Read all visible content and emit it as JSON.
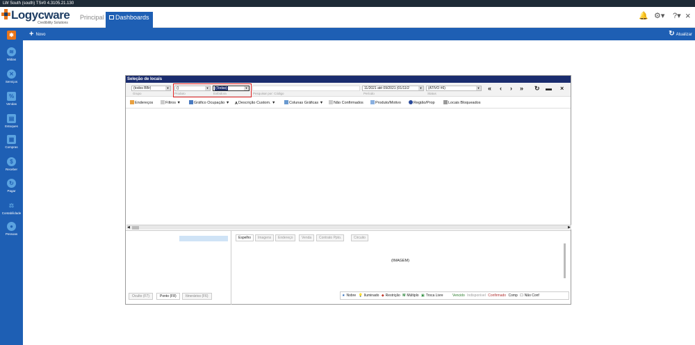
{
  "titlebar": {
    "text": "LW South (south) TS#0 4.3105.21.130"
  },
  "brand": {
    "name": "Logycware",
    "tagline": "Credibility Solutions"
  },
  "nav": {
    "tabs": [
      {
        "label": "Principal"
      },
      {
        "label": "Dashboards"
      }
    ]
  },
  "topicons": {
    "bell": "bell-icon",
    "settings": "gear-icon",
    "help": "?",
    "close": "×"
  },
  "actionbar": {
    "new_label": "Novo",
    "refresh_label": "Atualizar"
  },
  "sidebar": {
    "items": [
      {
        "label": "Mídias",
        "icon": "≋"
      },
      {
        "label": "Serviços",
        "icon": "✕"
      },
      {
        "label": "Vendas",
        "icon": "%"
      },
      {
        "label": "Estoques",
        "icon": "▤"
      },
      {
        "label": "Compras",
        "icon": "▦"
      },
      {
        "label": "Receber",
        "icon": "$"
      },
      {
        "label": "Pagar",
        "icon": "↻"
      },
      {
        "label": "Contabilidade",
        "icon": "⚖"
      },
      {
        "label": "Pessoas",
        "icon": "●"
      }
    ]
  },
  "dialog": {
    "title": "Seleção de locais",
    "filters": {
      "grupo": {
        "value": "(todos BBr)",
        "label": "Grupo"
      },
      "produto": {
        "value": "()",
        "label": "Produto"
      },
      "exibidora": {
        "value": "(Todas)",
        "label": "Exibidora"
      },
      "pesquisar": {
        "value": "",
        "label": "Pesquisar por: Código"
      },
      "periodo": {
        "value": "11/2021 até 09/2021 (01/11/2",
        "label": "Período"
      },
      "status": {
        "value": "(ATIVO #6)",
        "label": "Status"
      }
    },
    "nav_buttons": [
      "«",
      "‹",
      "›",
      "»",
      "↻",
      "▬",
      "×"
    ],
    "toolbar": [
      {
        "label": "Endereços"
      },
      {
        "label": "Filtros"
      },
      {
        "label": "Gráfico Ocupação"
      },
      {
        "label": "Descrição Custom."
      },
      {
        "label": "Colunas Gráficas"
      },
      {
        "label": "Não Confirmados"
      },
      {
        "label": "Produto/Motivo"
      },
      {
        "label": "Região/Prop"
      },
      {
        "label": "Locais Bloqueados"
      }
    ],
    "bottom_tabs": [
      {
        "label": "Oculto (F7)"
      },
      {
        "label": "Ponto (F8)"
      },
      {
        "label": "Itinerários (F6)"
      }
    ],
    "right_tabs": [
      {
        "label": "Espelho"
      },
      {
        "label": "Imagens"
      },
      {
        "label": "Endereço"
      },
      {
        "label": "Venda"
      },
      {
        "label": "Contrato Ppto."
      },
      {
        "label": "Circuito"
      }
    ],
    "image_placeholder": "(IMAGEM)",
    "legend": [
      {
        "label": "Nobre",
        "color": "#1e5fb4"
      },
      {
        "label": "Iluminado",
        "color": "#d6a800"
      },
      {
        "label": "Restrição",
        "color": "#c0392b"
      },
      {
        "label": "Múltiplo",
        "color": "#1a7a2a"
      },
      {
        "label": "Troca Livre",
        "color": "#2a8a3a"
      },
      {
        "label": "Vencido",
        "color": "#2a7a2a"
      },
      {
        "label": "Indisponível",
        "color": "#999999"
      },
      {
        "label": "Confirmado",
        "color": "#b03030"
      },
      {
        "label": "Comp",
        "color": "#222222"
      },
      {
        "label": "Não Conf",
        "color": "#222222"
      }
    ]
  }
}
